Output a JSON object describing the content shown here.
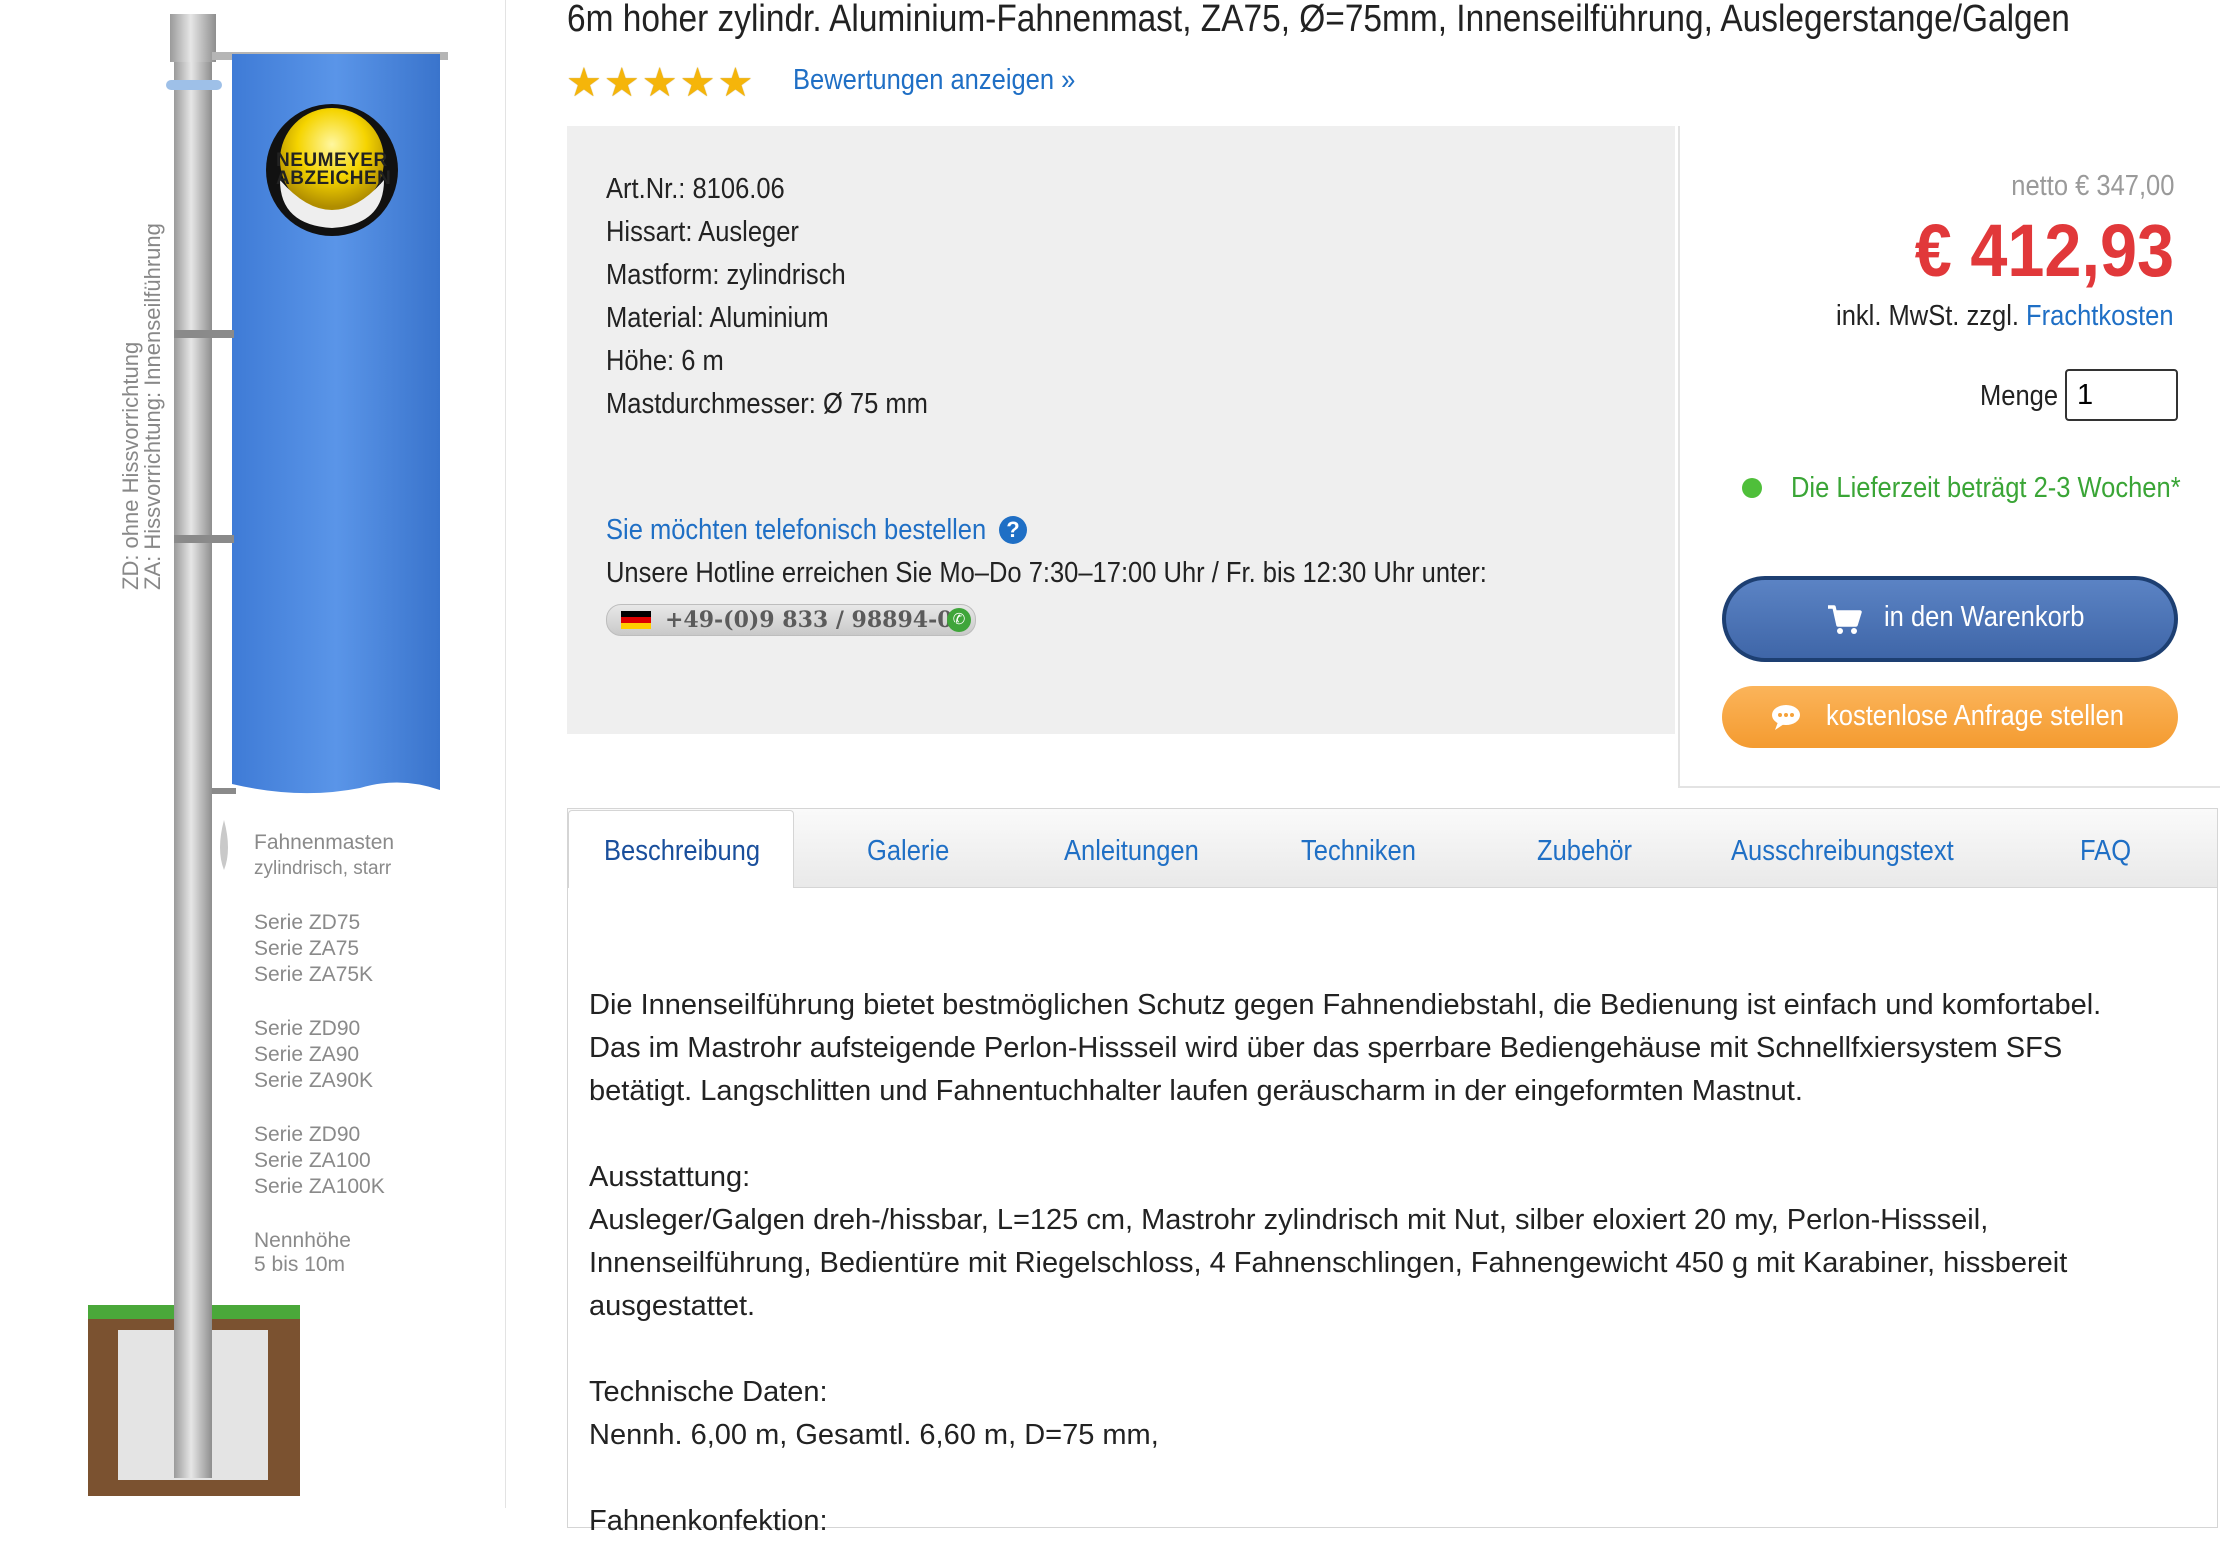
{
  "product": {
    "title": "6m hoher zylindr. Aluminium-Fahnenmast, ZA75, Ø=75mm, Innenseilführung, Auslegerstange/Galgen",
    "rating_stars": 5,
    "ratings_link": "Bewertungen anzeigen »"
  },
  "image_panel": {
    "vertical_text_1": "ZD: ohne Hissvorrichtung",
    "vertical_text_2": "ZA: Hissvorrichtung: Innenseilführung",
    "logo_line_1": "NEUMEYER",
    "logo_line_2": "ABZEICHEN",
    "group1": [
      "Fahnenmasten",
      "zylindrisch, starr"
    ],
    "group2": [
      "Serie ZD75",
      "Serie ZA75",
      "Serie ZA75K"
    ],
    "group3": [
      "Serie ZD90",
      "Serie ZA90",
      "Serie ZA90K"
    ],
    "group4": [
      "Serie ZD90",
      "Serie ZA100",
      "Serie ZA100K"
    ],
    "group5": [
      "Nennhöhe",
      "5 bis 10m"
    ]
  },
  "specs": [
    "Art.Nr.: 8106.06",
    "Hissart: Ausleger",
    "Mastform: zylindrisch",
    "Material: Aluminium",
    "Höhe: 6 m",
    "Mastdurchmesser: Ø 75 mm"
  ],
  "phone": {
    "link": "Sie möchten telefonisch bestellen",
    "hotline_text": "Unsere Hotline erreichen Sie Mo–Do 7:30–17:00 Uhr / Fr. bis 12:30 Uhr unter:",
    "number": "+49-(0)9 833 / 98894-0"
  },
  "pricing": {
    "netto": "netto € 347,00",
    "price": "€ 412,93",
    "vat_text": "inkl. MwSt. zzgl.",
    "shipping_link": "Frachtkosten",
    "quantity_label": "Menge",
    "quantity_value": "1",
    "availability": "Die Lieferzeit beträgt 2-3 Wochen*",
    "cart_button": "in den Warenkorb",
    "inquiry_button": "kostenlose Anfrage stellen"
  },
  "tabs": [
    "Beschreibung",
    "Galerie",
    "Anleitungen",
    "Techniken",
    "Zubehör",
    "Ausschreibungstext",
    "FAQ"
  ],
  "description": {
    "intro": "Die Innenseilführung bietet bestmöglichen Schutz gegen Fahnendiebstahl, die Bedienung ist einfach und komfortabel. Das im Mastrohr aufsteigende Perlon-Hissseil wird über das sperrbare Bediengehäuse mit Schnellfxiersystem SFS betätigt. Langschlitten und Fahnentuchhalter laufen geräuscharm in der eingeformten Mastnut.",
    "equipment_heading": "Ausstattung:",
    "equipment_text": "Ausleger/Galgen dreh-/hissbar, L=125 cm, Mastrohr zylindrisch mit Nut, silber eloxiert 20 my, Perlon-Hissseil, Innenseilführung, Bedientüre mit Riegelschloss, 4 Fahnenschlingen, Fahnengewicht 450 g mit Karabiner, hissbereit ausgestattet.",
    "tech_heading": "Technische Daten:",
    "tech_text": "Nennh. 6,00 m, Gesamtl. 6,60 m, D=75 mm,",
    "flag_heading": "Fahnenkonfektion:"
  },
  "colors": {
    "link": "#1f6fc5",
    "price": "#e1383a",
    "availability": "#3aa536",
    "cart_button": "#4a72b5",
    "inquiry_button": "#f5a23a",
    "flag_blue": "#4a86db",
    "info_bg": "#efefef"
  }
}
